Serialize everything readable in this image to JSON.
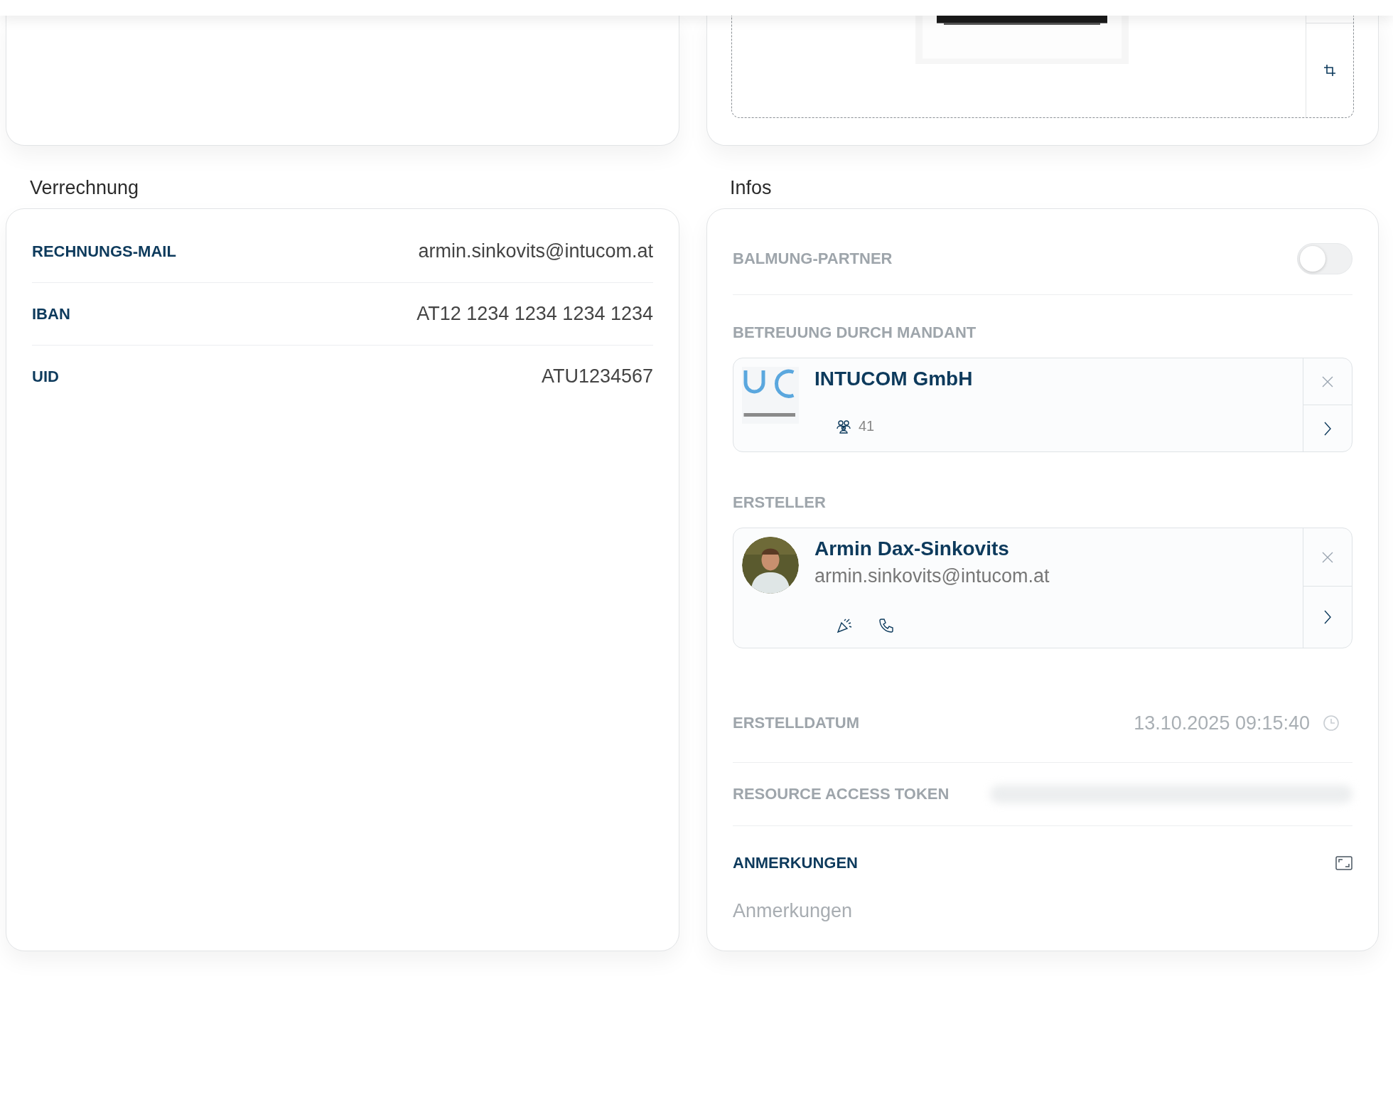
{
  "billing": {
    "title": "Verrechnung",
    "rows": [
      {
        "label": "RECHNUNGS-MAIL",
        "value": "armin.sinkovits@intucom.at"
      },
      {
        "label": "IBAN",
        "value": "AT12 1234 1234 1234 1234"
      },
      {
        "label": "UID",
        "value": "ATU1234567"
      }
    ]
  },
  "infos": {
    "title": "Infos",
    "partner": {
      "label": "BALMUNG-PARTNER",
      "on": false,
      "disabled": true
    },
    "mandant": {
      "label": "BETREUUNG DURCH MANDANT",
      "disabled": true,
      "name": "INTUCOM GmbH",
      "members": "41"
    },
    "creator": {
      "label": "ERSTELLER",
      "disabled": true,
      "name": "Armin Dax-Sinkovits",
      "email": "armin.sinkovits@intucom.at"
    },
    "created": {
      "label": "ERSTELLDATUM",
      "disabled": true,
      "value": "13.10.2025 09:15:40"
    },
    "token": {
      "label": "RESOURCE ACCESS TOKEN",
      "disabled": true
    },
    "notes": {
      "label": "ANMERKUNGEN",
      "disabled": false,
      "placeholder": "Anmerkungen"
    }
  }
}
